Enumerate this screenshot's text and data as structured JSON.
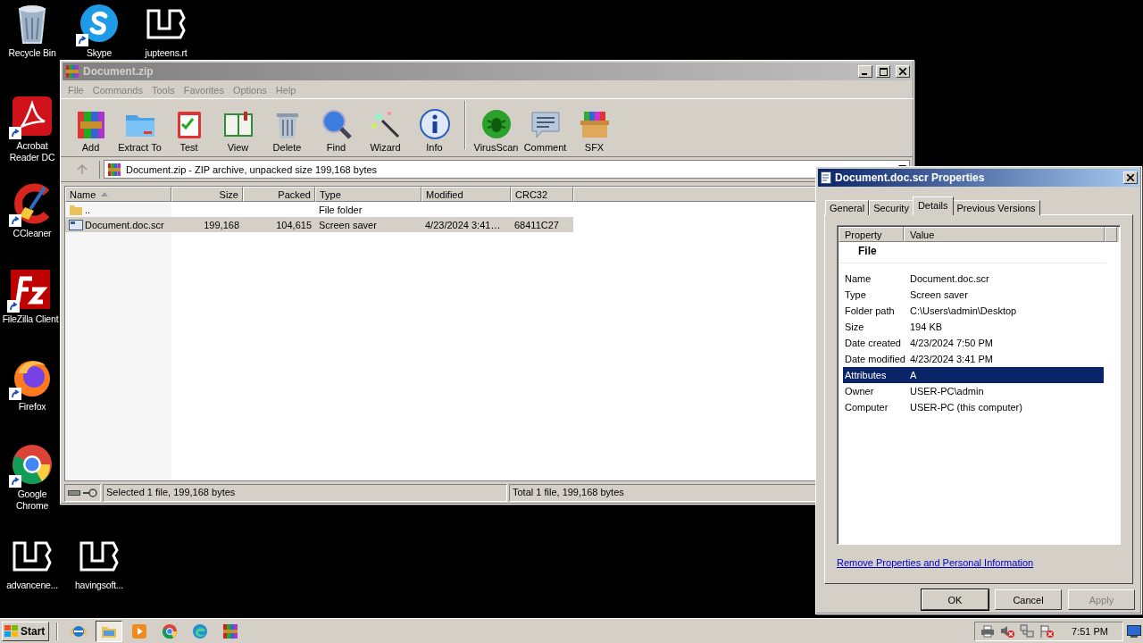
{
  "desktop": {
    "icons": [
      {
        "label": "Recycle Bin",
        "kind": "bin",
        "shortcut": false
      },
      {
        "label": "Skype",
        "kind": "chat",
        "shortcut": true
      },
      {
        "label": "jupteens.rt",
        "kind": "logo",
        "shortcut": false
      },
      {
        "label": "Acrobat Reader DC",
        "kind": "acrobat",
        "shortcut": true
      },
      {
        "label": "CCleaner",
        "kind": "ccleaner",
        "shortcut": true
      },
      {
        "label": "FileZilla Client",
        "kind": "filezilla",
        "shortcut": true
      },
      {
        "label": "Firefox",
        "kind": "firefox",
        "shortcut": true
      },
      {
        "label": "Google Chrome",
        "kind": "chrome",
        "shortcut": true
      },
      {
        "label": "advancene...",
        "kind": "logo",
        "shortcut": false
      },
      {
        "label": "havingsoft...",
        "kind": "logo",
        "shortcut": false
      }
    ]
  },
  "archive_window": {
    "title": "Document.zip",
    "active": false,
    "menu": [
      "File",
      "Commands",
      "Tools",
      "Favorites",
      "Options",
      "Help"
    ],
    "toolbar_groups": [
      {
        "buttons": [
          {
            "label": "Add",
            "kind": "add"
          },
          {
            "label": "Extract To",
            "kind": "extract"
          },
          {
            "label": "Test",
            "kind": "test"
          },
          {
            "label": "View",
            "kind": "view"
          },
          {
            "label": "Delete",
            "kind": "delete"
          },
          {
            "label": "Find",
            "kind": "find"
          },
          {
            "label": "Wizard",
            "kind": "wizard"
          },
          {
            "label": "Info",
            "kind": "info"
          }
        ]
      },
      {
        "buttons": [
          {
            "label": "VirusScan",
            "kind": "virus"
          },
          {
            "label": "Comment",
            "kind": "comment"
          },
          {
            "label": "SFX",
            "kind": "sfx"
          }
        ]
      }
    ],
    "address": "Document.zip - ZIP archive, unpacked size 199,168 bytes",
    "columns": [
      {
        "label": "Name",
        "sorted": true
      },
      {
        "label": "Size",
        "sorted": false
      },
      {
        "label": "Packed",
        "sorted": false
      },
      {
        "label": "Type",
        "sorted": false
      },
      {
        "label": "Modified",
        "sorted": false
      },
      {
        "label": "CRC32",
        "sorted": false
      }
    ],
    "rows": [
      {
        "kind": "folder",
        "name": "..",
        "type": "File folder",
        "selected": false
      },
      {
        "kind": "file",
        "name": "Document.doc.scr",
        "size": "199,168",
        "packed": "104,615",
        "type": "Screen saver",
        "modified": "4/23/2024 3:41…",
        "crc32": "68411C27",
        "selected": true
      }
    ],
    "status": [
      "Selected 1 file, 199,168 bytes",
      "Total 1 file, 199,168 bytes"
    ]
  },
  "properties_dialog": {
    "title": "Document.doc.scr Properties",
    "active": true,
    "tabs": [
      {
        "label": "General",
        "selected": false
      },
      {
        "label": "Security",
        "selected": false
      },
      {
        "label": "Details",
        "selected": true
      },
      {
        "label": "Previous Versions",
        "selected": false
      }
    ],
    "columns": [
      "Property",
      "Value"
    ],
    "group": "File",
    "rows": [
      {
        "property": "Name",
        "value": "Document.doc.scr",
        "selected": false
      },
      {
        "property": "Type",
        "value": "Screen saver",
        "selected": false
      },
      {
        "property": "Folder path",
        "value": "C:\\Users\\admin\\Desktop",
        "selected": false
      },
      {
        "property": "Size",
        "value": "194 KB",
        "selected": false
      },
      {
        "property": "Date created",
        "value": "4/23/2024 7:50 PM",
        "selected": false
      },
      {
        "property": "Date modified",
        "value": "4/23/2024 3:41 PM",
        "selected": false
      },
      {
        "property": "Attributes",
        "value": "A",
        "selected": true
      },
      {
        "property": "Owner",
        "value": "USER-PC\\admin",
        "selected": false
      },
      {
        "property": "Computer",
        "value": "USER-PC (this computer)",
        "selected": false
      }
    ],
    "link": "Remove Properties and Personal Information",
    "buttons": [
      {
        "label": "OK",
        "default": true,
        "disabled": false
      },
      {
        "label": "Cancel",
        "default": false,
        "disabled": false
      },
      {
        "label": "Apply",
        "default": false,
        "disabled": true
      }
    ]
  },
  "taskbar": {
    "start": "Start",
    "apps": [
      {
        "kind": "ie",
        "selected": false
      },
      {
        "kind": "explorer",
        "selected": true
      },
      {
        "kind": "media",
        "selected": false
      },
      {
        "kind": "chrome",
        "selected": false
      },
      {
        "kind": "edge",
        "selected": false
      },
      {
        "kind": "winrar",
        "selected": false
      }
    ],
    "tray": [
      {
        "kind": "printer"
      },
      {
        "kind": "speaker"
      },
      {
        "kind": "network"
      },
      {
        "kind": "flag"
      }
    ],
    "clock": "7:51 PM"
  }
}
